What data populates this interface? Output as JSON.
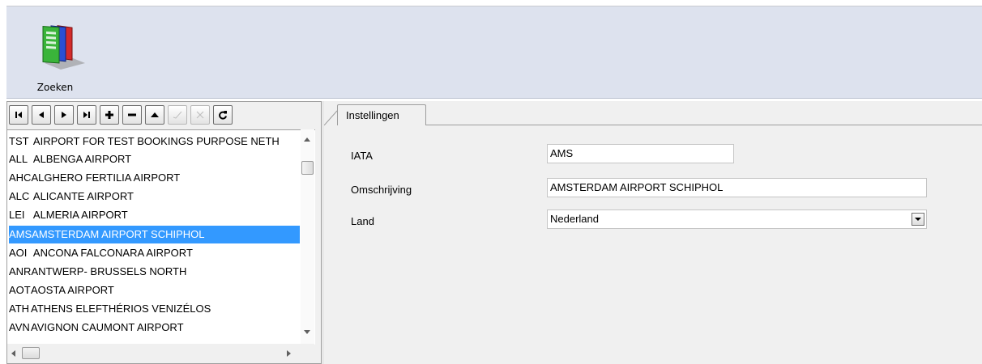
{
  "toolbar": {
    "search_label": "Zoeken",
    "search_icon": "colored-cards-icon"
  },
  "navigator": {
    "buttons": [
      {
        "name": "first-record-button",
        "icon": "skip-first-icon",
        "enabled": true
      },
      {
        "name": "prior-record-button",
        "icon": "triangle-left-icon",
        "enabled": true
      },
      {
        "name": "next-record-button",
        "icon": "triangle-right-icon",
        "enabled": true
      },
      {
        "name": "last-record-button",
        "icon": "skip-last-icon",
        "enabled": true
      },
      {
        "name": "insert-record-button",
        "icon": "plus-icon",
        "enabled": true
      },
      {
        "name": "delete-record-button",
        "icon": "minus-icon",
        "enabled": true
      },
      {
        "name": "edit-record-button",
        "icon": "triangle-up-icon",
        "enabled": true
      },
      {
        "name": "post-record-button",
        "icon": "checkmark-icon",
        "enabled": false
      },
      {
        "name": "cancel-record-button",
        "icon": "x-icon",
        "enabled": false
      },
      {
        "name": "refresh-button",
        "icon": "refresh-icon",
        "enabled": true
      }
    ]
  },
  "airports": [
    {
      "code": "TST",
      "name": "AIRPORT FOR TEST BOOKINGS PURPOSE NETH"
    },
    {
      "code": "ALL",
      "name": "ALBENGA AIRPORT"
    },
    {
      "code": "AHC",
      "name": "ALGHERO FERTILIA AIRPORT"
    },
    {
      "code": "ALC",
      "name": "ALICANTE AIRPORT"
    },
    {
      "code": "LEI",
      "name": "ALMERIA AIRPORT"
    },
    {
      "code": "AMS",
      "name": "AMSTERDAM AIRPORT SCHIPHOL",
      "selected": true
    },
    {
      "code": "AOI",
      "name": "ANCONA FALCONARA AIRPORT"
    },
    {
      "code": "ANR",
      "name": "ANTWERP- BRUSSELS NORTH"
    },
    {
      "code": "AOT",
      "name": "AOSTA AIRPORT"
    },
    {
      "code": "ATH",
      "name": "ATHENS ELEFTHÉRIOS VENIZÉLOS"
    },
    {
      "code": "AVN",
      "name": "AVIGNON CAUMONT AIRPORT"
    }
  ],
  "detail": {
    "tab_label": "Instellingen",
    "iata_label": "IATA",
    "iata_value": "AMS",
    "description_label": "Omschrijving",
    "description_value": "AMSTERDAM AIRPORT SCHIPHOL",
    "country_label": "Land",
    "country_value": "Nederland"
  },
  "colors": {
    "ribbon_bg": "#dde2ee",
    "selection": "#3399ff"
  }
}
